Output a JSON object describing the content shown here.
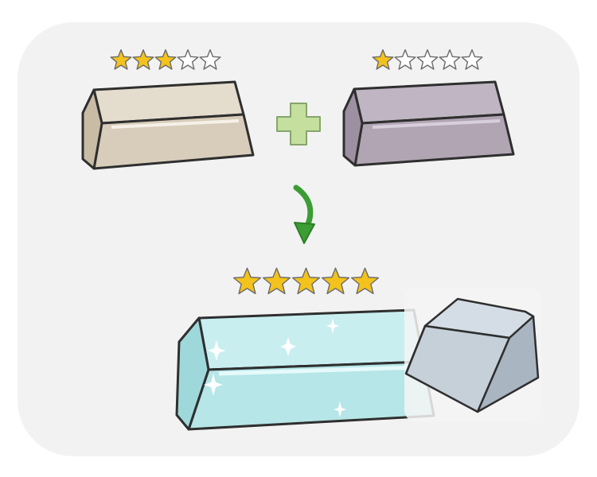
{
  "rating_scale_max": 5,
  "ingots": {
    "beige": {
      "rating": 3,
      "color": "#d8cdbb"
    },
    "purple": {
      "rating": 1,
      "color": "#b1a5b4"
    },
    "cyan_result": {
      "rating": 5,
      "color": "#b6e6e7"
    }
  },
  "colors": {
    "star_fill": "#f3c21c",
    "star_outline": "#6b6b6b",
    "plus": "#c4df9e",
    "arrow": "#3b9d33",
    "keycap": "#c5d0d9"
  },
  "icons": {
    "plus": "plus-icon",
    "arrow": "curved-arrow-down-icon",
    "sparkle": "sparkle-icon",
    "star": "star-icon"
  }
}
